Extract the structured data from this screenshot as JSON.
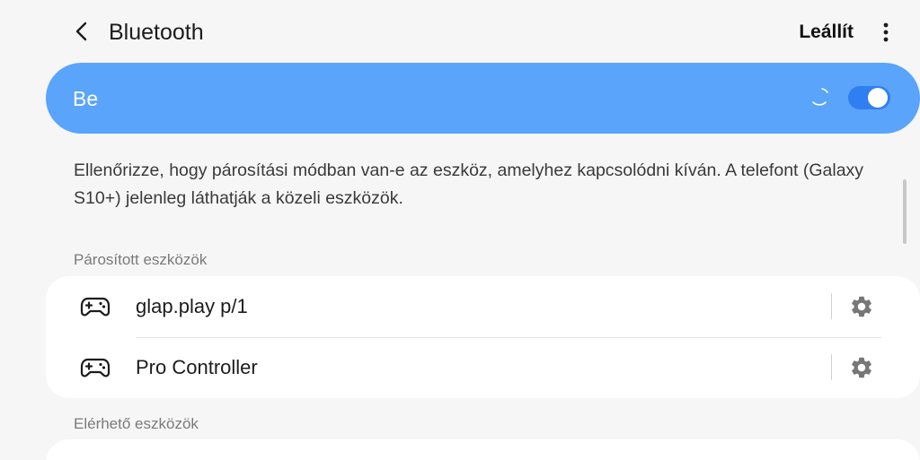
{
  "header": {
    "title": "Bluetooth",
    "back_icon": "back-arrow-icon",
    "stop_label": "Leállít",
    "more_icon": "more-vertical-icon"
  },
  "master_switch": {
    "label": "Be",
    "state": "on",
    "accent_color": "#5aa4fb",
    "toggle_color": "#2f7ff0"
  },
  "description": "Ellenőrizze, hogy párosítási módban van-e az eszköz, amelyhez kapcsolódni kíván. A telefont (Galaxy S10+) jelenleg láthatják a közeli eszközök.",
  "paired": {
    "header": "Párosított eszközök",
    "devices": [
      {
        "name": "glap.play p/1",
        "icon": "gamepad-icon",
        "settings_icon": "gear-icon"
      },
      {
        "name": "Pro Controller",
        "icon": "gamepad-icon",
        "settings_icon": "gear-icon"
      }
    ]
  },
  "available": {
    "header": "Elérhető eszközök"
  }
}
